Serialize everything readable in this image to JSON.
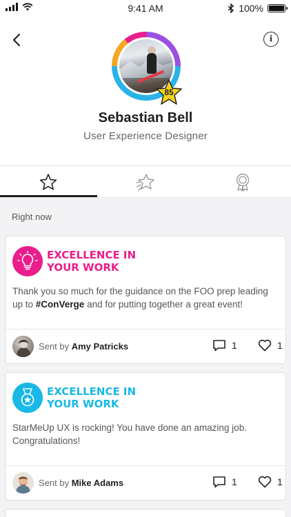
{
  "status_bar": {
    "time": "9:41 AM",
    "battery": "100%"
  },
  "header": {
    "back_icon": "chevron-left-icon",
    "info_icon": "info-icon",
    "score": "85",
    "name": "Sebastian Bell",
    "role": "User Experience Designer",
    "ring_colors": [
      "#f5a623",
      "#e91e8c",
      "#9b51e0",
      "#2ab3e6"
    ]
  },
  "tabs": [
    {
      "icon": "star-icon",
      "active": true
    },
    {
      "icon": "shooting-star-icon",
      "active": false
    },
    {
      "icon": "award-ribbon-icon",
      "active": false
    }
  ],
  "section_label": "Right now",
  "cards": [
    {
      "badge_icon": "lightbulb-icon",
      "badge_color": "#e91e8c",
      "title": "EXCELLENCE IN YOUR WORK",
      "message_before": "Thank you so much for the guidance on the FOO prep leading up to ",
      "message_hashtag": "#ConVerge",
      "message_after": " and for putting together a great event!",
      "sent_by_label": "Sent by",
      "sender": "Amy Patricks",
      "comments": "1",
      "likes": "1"
    },
    {
      "badge_icon": "medal-icon",
      "badge_color": "#19b8e6",
      "title": "EXCELLENCE IN YOUR WORK",
      "message": "StarMeUp UX is rocking! You have done an amazing job. Congratulations!",
      "sent_by_label": "Sent by",
      "sender": "Mike Adams",
      "comments": "1",
      "likes": "1"
    }
  ]
}
